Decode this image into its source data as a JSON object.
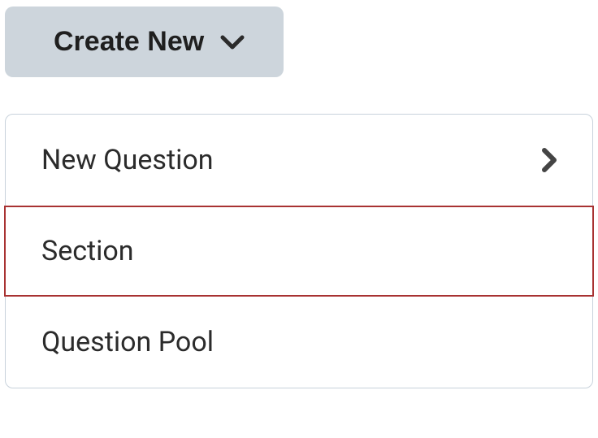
{
  "button": {
    "label": "Create New"
  },
  "menu": {
    "items": [
      {
        "label": "New Question",
        "hasSubmenu": true
      },
      {
        "label": "Section",
        "hasSubmenu": false,
        "highlighted": true
      },
      {
        "label": "Question Pool",
        "hasSubmenu": false
      }
    ]
  }
}
